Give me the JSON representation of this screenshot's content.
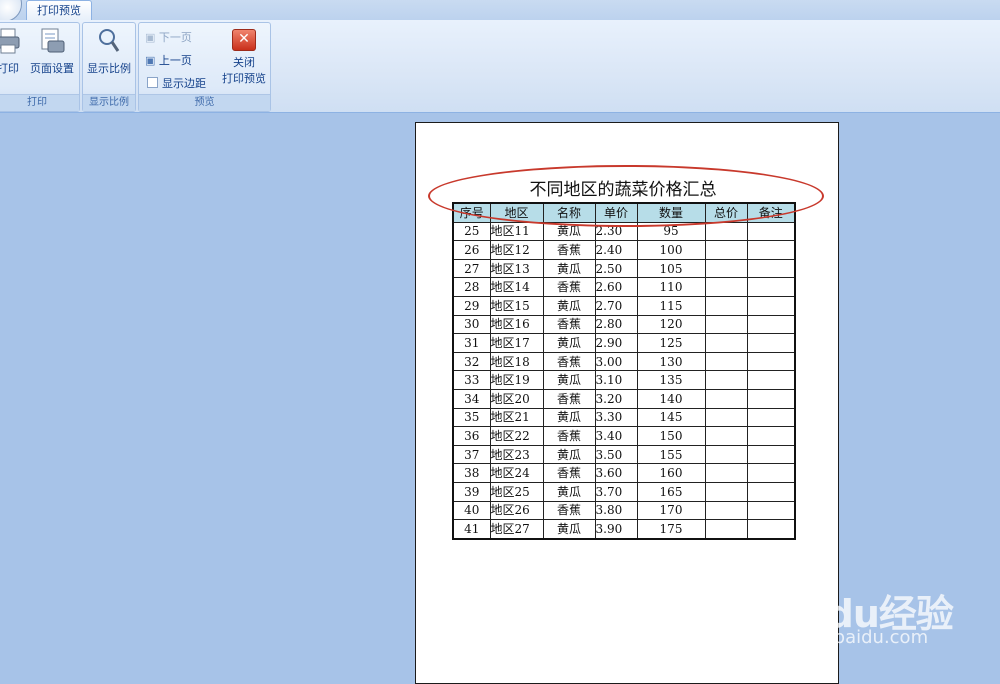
{
  "ribbon": {
    "tab": "打印预览",
    "groups": {
      "print": {
        "label": "打印",
        "print_btn": "打印",
        "page_setup_btn": "页面设置"
      },
      "zoom": {
        "label": "显示比例",
        "zoom_btn": "显示比例"
      },
      "preview": {
        "label": "预览",
        "next_page": "下一页",
        "prev_page": "上一页",
        "show_margins": "显示边距",
        "close_line1": "关闭",
        "close_line2": "打印预览"
      }
    }
  },
  "sheet": {
    "title": "不同地区的蔬菜价格汇总",
    "headers": [
      "序号",
      "地区",
      "名称",
      "单价",
      "数量",
      "总价",
      "备注"
    ],
    "rows": [
      [
        "25",
        "地区11",
        "黄瓜",
        "2.30",
        "95",
        "",
        ""
      ],
      [
        "26",
        "地区12",
        "香蕉",
        "2.40",
        "100",
        "",
        ""
      ],
      [
        "27",
        "地区13",
        "黄瓜",
        "2.50",
        "105",
        "",
        ""
      ],
      [
        "28",
        "地区14",
        "香蕉",
        "2.60",
        "110",
        "",
        ""
      ],
      [
        "29",
        "地区15",
        "黄瓜",
        "2.70",
        "115",
        "",
        ""
      ],
      [
        "30",
        "地区16",
        "香蕉",
        "2.80",
        "120",
        "",
        ""
      ],
      [
        "31",
        "地区17",
        "黄瓜",
        "2.90",
        "125",
        "",
        ""
      ],
      [
        "32",
        "地区18",
        "香蕉",
        "3.00",
        "130",
        "",
        ""
      ],
      [
        "33",
        "地区19",
        "黄瓜",
        "3.10",
        "135",
        "",
        ""
      ],
      [
        "34",
        "地区20",
        "香蕉",
        "3.20",
        "140",
        "",
        ""
      ],
      [
        "35",
        "地区21",
        "黄瓜",
        "3.30",
        "145",
        "",
        ""
      ],
      [
        "36",
        "地区22",
        "香蕉",
        "3.40",
        "150",
        "",
        ""
      ],
      [
        "37",
        "地区23",
        "黄瓜",
        "3.50",
        "155",
        "",
        ""
      ],
      [
        "38",
        "地区24",
        "香蕉",
        "3.60",
        "160",
        "",
        ""
      ],
      [
        "39",
        "地区25",
        "黄瓜",
        "3.70",
        "165",
        "",
        ""
      ],
      [
        "40",
        "地区26",
        "香蕉",
        "3.80",
        "170",
        "",
        ""
      ],
      [
        "41",
        "地区27",
        "黄瓜",
        "3.90",
        "175",
        "",
        ""
      ]
    ]
  },
  "watermark": {
    "logo": "Baidu经验",
    "url": "jingyan.baidu.com"
  },
  "colors": {
    "workspace": "#a7c3e8",
    "header_fill": "#b7dde8",
    "annotation_ellipse": "#c8392c"
  }
}
